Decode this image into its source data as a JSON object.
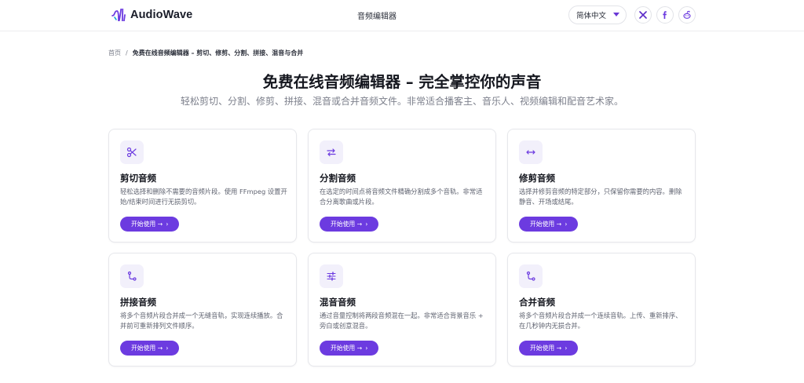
{
  "header": {
    "brand": "AudioWave",
    "nav_label": "音频编辑器",
    "language": "简体中文",
    "social": [
      "x-icon",
      "facebook-icon",
      "reddit-icon"
    ]
  },
  "breadcrumb": {
    "home": "首页",
    "separator": "/",
    "current": "免费在线音频编辑器 – 剪切、修剪、分割、拼接、混音与合并"
  },
  "hero": {
    "title": "免费在线音频编辑器 – 完全掌控你的声音",
    "subtitle": "轻松剪切、分割、修剪、拼接、混音或合并音频文件。非常适合播客主、音乐人、视频编辑和配音艺术家。"
  },
  "colors": {
    "accent": "#6c3be0",
    "icon_bg": "#f2f0fb"
  },
  "cards": [
    {
      "icon": "scissors-icon",
      "title": "剪切音频",
      "desc": "轻松选择和删除不需要的音频片段。使用 FFmpeg 设置开始/结束时间进行无损剪切。",
      "button": "开始使用 →"
    },
    {
      "icon": "split-arrows-icon",
      "title": "分割音频",
      "desc": "在选定的时间点将音频文件精确分割成多个音轨。非常适合分离歌曲或片段。",
      "button": "开始使用 →"
    },
    {
      "icon": "trim-arrows-icon",
      "title": "修剪音频",
      "desc": "选择并修剪音频的特定部分，只保留你需要的内容。删除静音、开场或结尾。",
      "button": "开始使用 →"
    },
    {
      "icon": "join-path-icon",
      "title": "拼接音频",
      "desc": "将多个音频片段合并成一个无缝音轨，实现连续播放。合并前可重新排列文件顺序。",
      "button": "开始使用 →"
    },
    {
      "icon": "sliders-icon",
      "title": "混音音频",
      "desc": "通过音量控制将两段音频混在一起。非常适合背景音乐 + 旁白或创意混音。",
      "button": "开始使用 →"
    },
    {
      "icon": "merge-path-icon",
      "title": "合并音频",
      "desc": "将多个音频片段合并成一个连续音轨。上传、重新排序、在几秒钟内无损合并。",
      "button": "开始使用 →"
    }
  ]
}
